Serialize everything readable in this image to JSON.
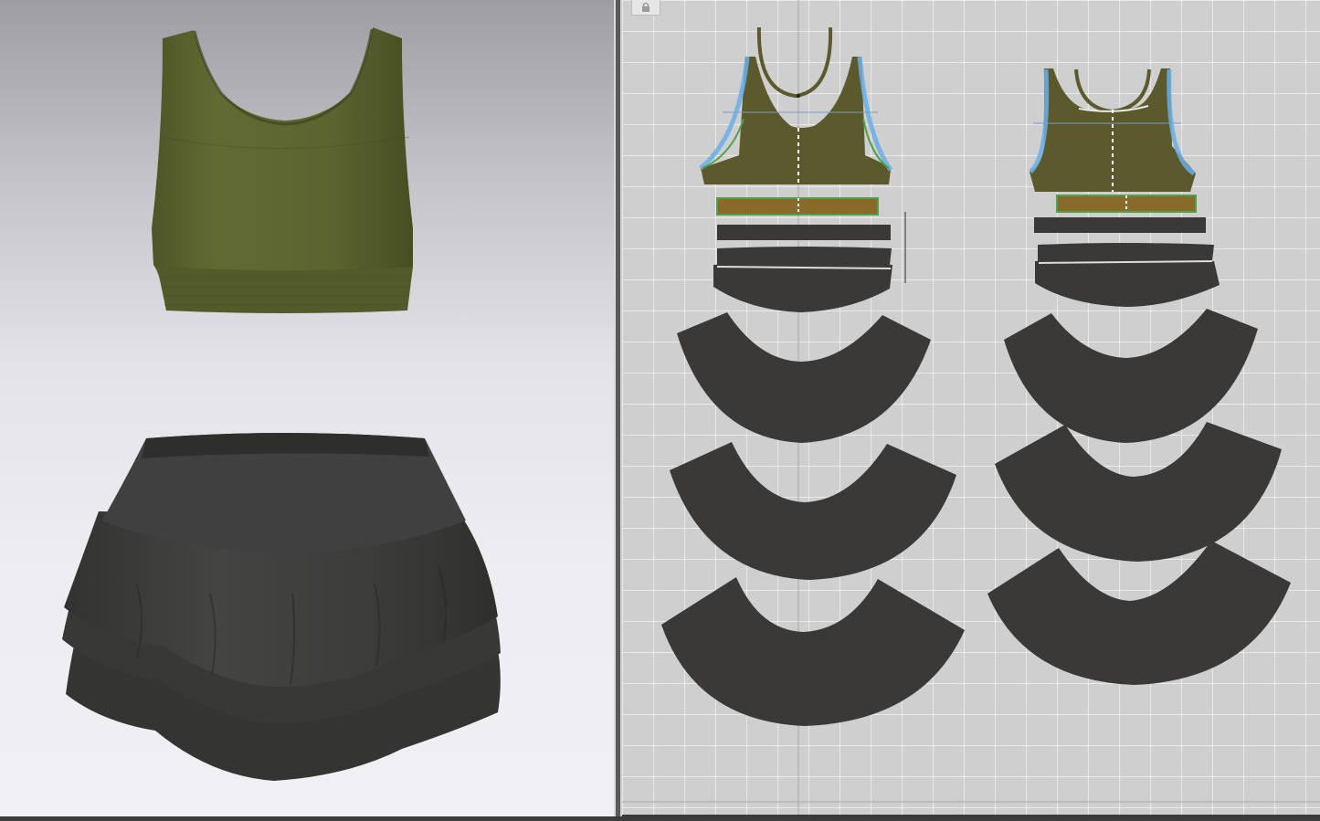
{
  "app": {
    "views": [
      "3d-garment-view",
      "2d-pattern-view"
    ]
  },
  "colors": {
    "bra_fabric": "#5a6230",
    "bra_band": "#4f5628",
    "skirt_fabric": "#3b3b3a",
    "pattern_piece": "#3a3937",
    "pattern_bra": "#5c5a2c",
    "pattern_binding": "#8a6a28",
    "stitch_blue": "#6aaee8",
    "stitch_green": "#4fa24a",
    "grid_bg": "#cfcfcf"
  },
  "toolbar": {
    "lock_icon": "lock-icon"
  }
}
